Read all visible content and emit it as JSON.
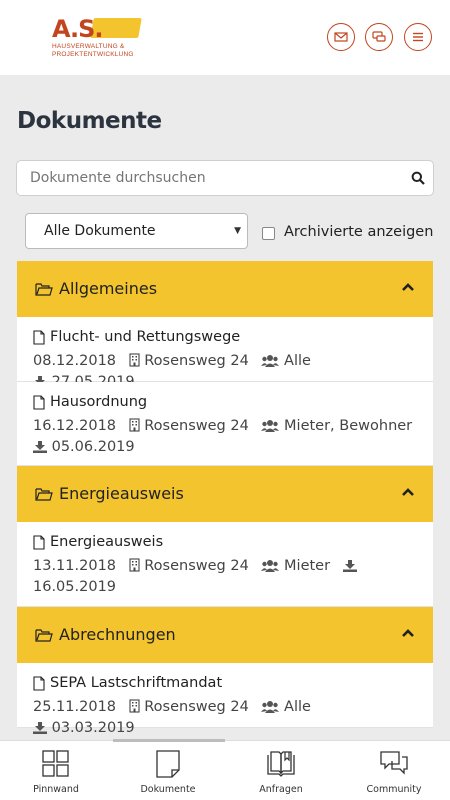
{
  "header": {
    "logo_mark": "A.S.",
    "logo_line1": "HAUSVERWALTUNG &",
    "logo_line2": "PROJEKTENTWICKLUNG",
    "brand_color": "#c2451e",
    "icons": [
      "mail-icon",
      "chat-icon",
      "menu-icon"
    ]
  },
  "page": {
    "title": "Dokumente"
  },
  "search": {
    "placeholder": "Dokumente durchsuchen",
    "value": ""
  },
  "filter": {
    "selected": "Alle Dokumente",
    "archived_label": "Archivierte anzeigen",
    "archived_checked": false
  },
  "accent_color": "#f3c42e",
  "sections": [
    {
      "title": "Allgemeines",
      "expanded": true,
      "documents": [
        {
          "name": "Flucht- und Rettungswege",
          "date": "08.12.2018",
          "location": "Rosensweg 24",
          "audience": "Alle",
          "download": "27.05.2019"
        },
        {
          "name": "Hausordnung",
          "date": "16.12.2018",
          "location": "Rosensweg 24",
          "audience": "Mieter, Bewohner",
          "download": "05.06.2019"
        }
      ]
    },
    {
      "title": "Energieausweis",
      "expanded": true,
      "documents": [
        {
          "name": "Energieausweis",
          "date": "13.11.2018",
          "location": "Rosensweg 24",
          "audience": "Mieter",
          "download": "16.05.2019"
        }
      ]
    },
    {
      "title": "Abrechnungen",
      "expanded": true,
      "documents": [
        {
          "name": "SEPA Lastschriftmandat",
          "date": "25.11.2018",
          "location": "Rosensweg 24",
          "audience": "Alle",
          "download": "03.03.2019"
        }
      ]
    }
  ],
  "bottom_nav": [
    {
      "label": "Pinnwand",
      "icon": "grid-icon",
      "active": false
    },
    {
      "label": "Dokumente",
      "icon": "document-icon",
      "active": true
    },
    {
      "label": "Anfragen",
      "icon": "book-icon",
      "active": false
    },
    {
      "label": "Community",
      "icon": "chat-bubbles-icon",
      "active": false
    }
  ]
}
